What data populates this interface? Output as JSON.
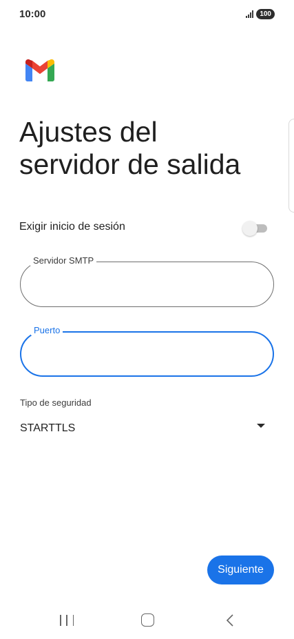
{
  "status_bar": {
    "time": "10:00",
    "battery": "100",
    "icons": [
      "signal-icon",
      "battery-icon"
    ]
  },
  "app": {
    "logo_icon": "gmail-logo"
  },
  "page": {
    "title_line1": "Ajustes del",
    "title_line2": "servidor de salida"
  },
  "form": {
    "require_login": {
      "label": "Exigir inicio de sesión",
      "enabled": false
    },
    "smtp_server": {
      "label": "Servidor SMTP",
      "value": ""
    },
    "port": {
      "label": "Puerto",
      "value": ""
    },
    "security_type": {
      "label": "Tipo de seguridad",
      "value": "STARTTLS"
    }
  },
  "actions": {
    "next_label": "Siguiente"
  },
  "nav": {
    "icons": [
      "recent-apps-icon",
      "home-icon",
      "back-icon"
    ]
  },
  "colors": {
    "accent": "#1a73e8",
    "text": "#1f1f1f"
  }
}
